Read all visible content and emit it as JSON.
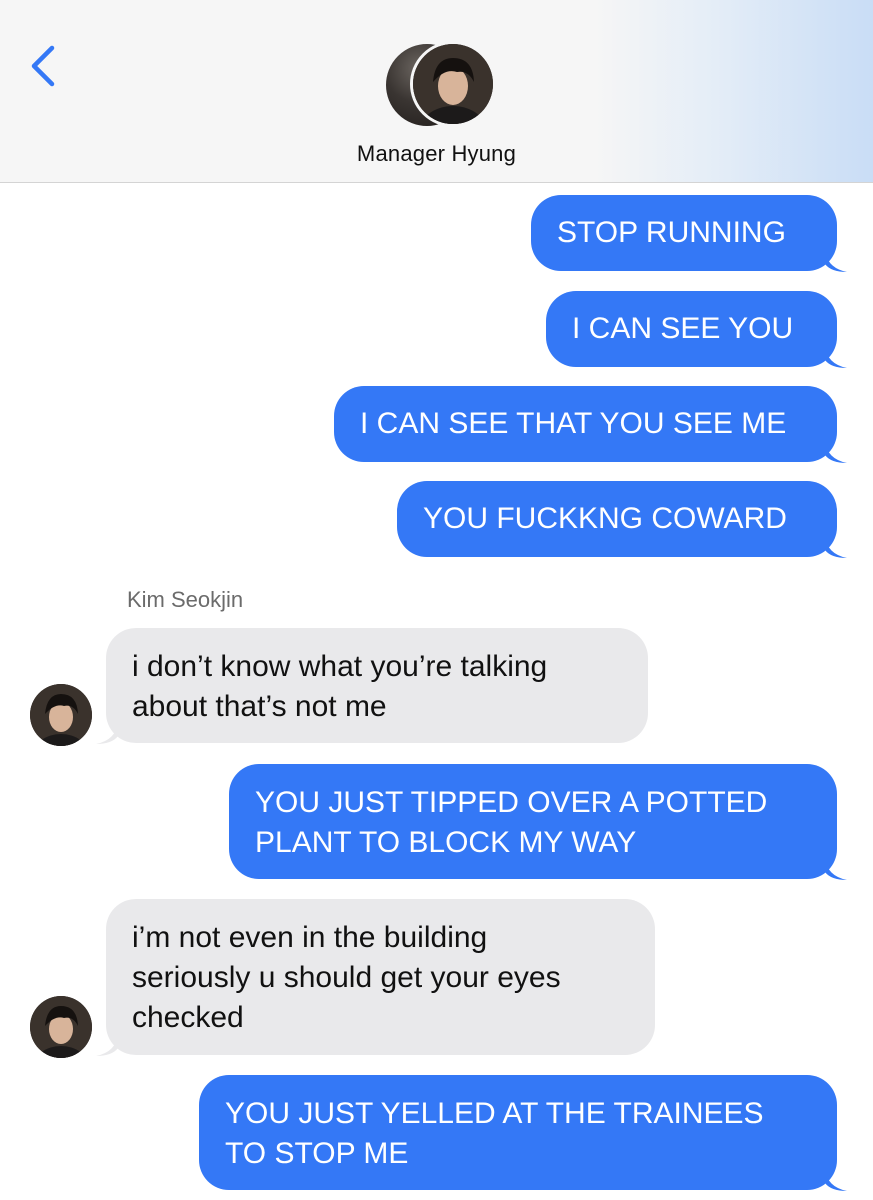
{
  "header": {
    "contact_name": "Manager Hyung"
  },
  "colors": {
    "outgoing_bubble": "#3478f6",
    "incoming_bubble": "#e9e9eb",
    "accent": "#3478f6"
  },
  "thread": {
    "sender_name": "Kim Seokjin",
    "messages": [
      {
        "direction": "outgoing",
        "lines": [
          "STOP RUNNING"
        ]
      },
      {
        "direction": "outgoing",
        "lines": [
          "I CAN SEE YOU"
        ]
      },
      {
        "direction": "outgoing",
        "lines": [
          "I CAN SEE THAT YOU SEE ME"
        ]
      },
      {
        "direction": "outgoing",
        "lines": [
          "YOU FUCKKNG COWARD"
        ]
      },
      {
        "direction": "incoming",
        "lines": [
          "i don’t know what you’re talking",
          "about that’s not me"
        ]
      },
      {
        "direction": "outgoing",
        "lines": [
          "YOU JUST TIPPED OVER A POTTED",
          "PLANT TO BLOCK MY WAY"
        ]
      },
      {
        "direction": "incoming",
        "lines": [
          "i’m not even in the building",
          "seriously u should get your eyes",
          "checked"
        ]
      },
      {
        "direction": "outgoing",
        "lines": [
          "YOU JUST YELLED AT THE TRAINEES",
          "TO STOP ME"
        ]
      }
    ]
  },
  "icons": {
    "back": "chevron-left-icon",
    "avatar": "avatar"
  }
}
